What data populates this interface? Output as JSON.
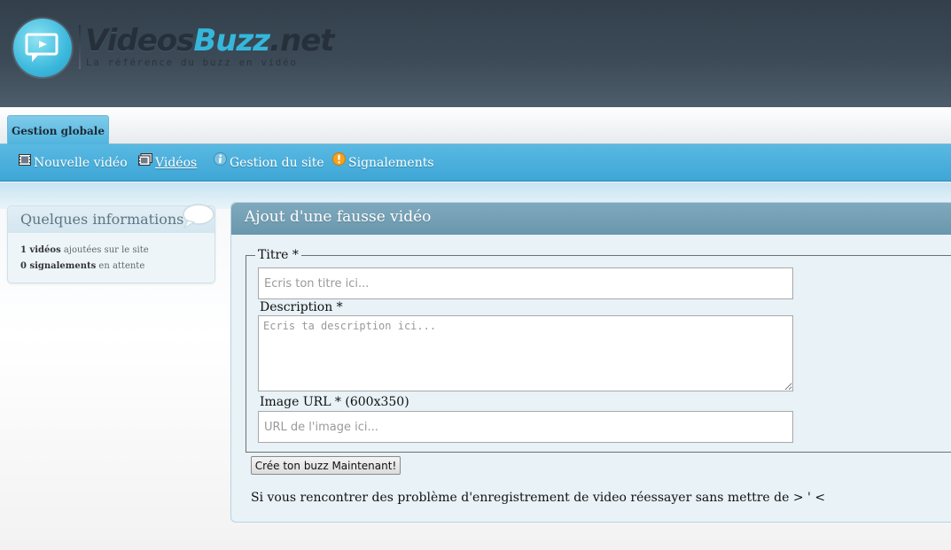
{
  "brand": {
    "name_part1": "Videos",
    "name_part2": "Buzz",
    "name_part3": ".net",
    "tagline": "La référence du buzz en vidéo",
    "accent_color": "#35b7db"
  },
  "tabs": [
    {
      "label": "Gestion globale",
      "active": true
    }
  ],
  "nav": {
    "items": [
      {
        "label": "Nouvelle vidéo",
        "icon": "film-icon"
      },
      {
        "label": "Vidéos",
        "icon": "film-stack-icon",
        "current": true
      },
      {
        "label": "Gestion du site",
        "icon": "info-icon"
      },
      {
        "label": "Signalements",
        "icon": "warning-icon"
      }
    ]
  },
  "sidebar": {
    "title": "Quelques informations",
    "icon": "speech-bubble-icon",
    "stats": [
      {
        "count": "1 vidéos",
        "text": " ajoutées sur le site"
      },
      {
        "count": "0 signalements",
        "text": " en attente"
      }
    ]
  },
  "form": {
    "title": "Ajout d'une fausse vidéo",
    "legend": "Titre *",
    "title_placeholder": "Ecris ton titre ici...",
    "description_label": "Description *",
    "description_placeholder": "Ecris ta description ici...",
    "image_label": "Image URL * (600x350)",
    "image_placeholder": "URL de l'image ici...",
    "submit_label": "Crée ton buzz Maintenant!",
    "note": "Si vous rencontrer des problème d'enregistrement de video réessayer sans mettre de > ' <"
  }
}
